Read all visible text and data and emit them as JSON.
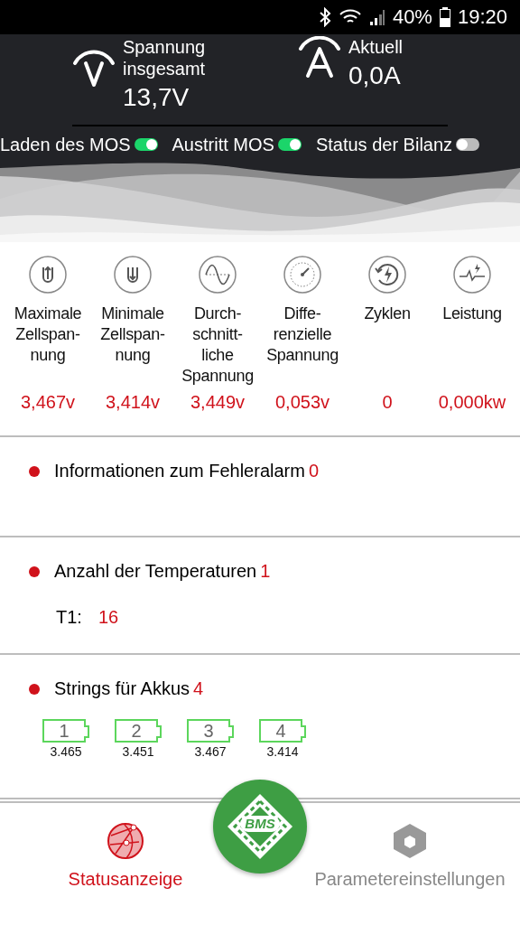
{
  "status_bar": {
    "battery_percent": "40%",
    "time": "19:20"
  },
  "summary": {
    "voltage_label": "Spannung insgesamt",
    "voltage_value": "13,7V",
    "current_label": "Aktuell",
    "current_value": "0,0A"
  },
  "switches": [
    {
      "label": "Laden des MOS",
      "on": true
    },
    {
      "label": "Austritt MOS",
      "on": true
    },
    {
      "label": "Status der Bilanz",
      "on": false
    }
  ],
  "metrics": [
    {
      "label": "Maximale Zellspan-\nnung",
      "value": "3,467v"
    },
    {
      "label": "Minimale Zellspan-\nnung",
      "value": "3,414v"
    },
    {
      "label": "Durch-\nschnitt-\nliche\nSpannung",
      "value": "3,449v"
    },
    {
      "label": "Diffe-\nrenzielle\nSpannung",
      "value": "0,053v"
    },
    {
      "label": "Zyklen",
      "value": "0"
    },
    {
      "label": "Leistung",
      "value": "0,000kw"
    }
  ],
  "sections": [
    {
      "title": "Informationen zum Fehleralarm",
      "count": "0"
    },
    {
      "title": "Anzahl der Temperaturen",
      "count": "1",
      "temperatures": [
        {
          "label": "T1:",
          "value": "16"
        }
      ]
    },
    {
      "title": "Strings für Akkus",
      "count": "4",
      "cells": [
        {
          "number": "1",
          "voltage": "3.465"
        },
        {
          "number": "2",
          "voltage": "3.451"
        },
        {
          "number": "3",
          "voltage": "3.467"
        },
        {
          "number": "4",
          "voltage": "3.414"
        }
      ]
    }
  ],
  "bottom_nav": {
    "tabs": [
      {
        "label": "Statusanzeige",
        "selected": true
      },
      {
        "label": "Parametereinstellungen",
        "selected": false
      }
    ],
    "center_button": "BMS"
  }
}
